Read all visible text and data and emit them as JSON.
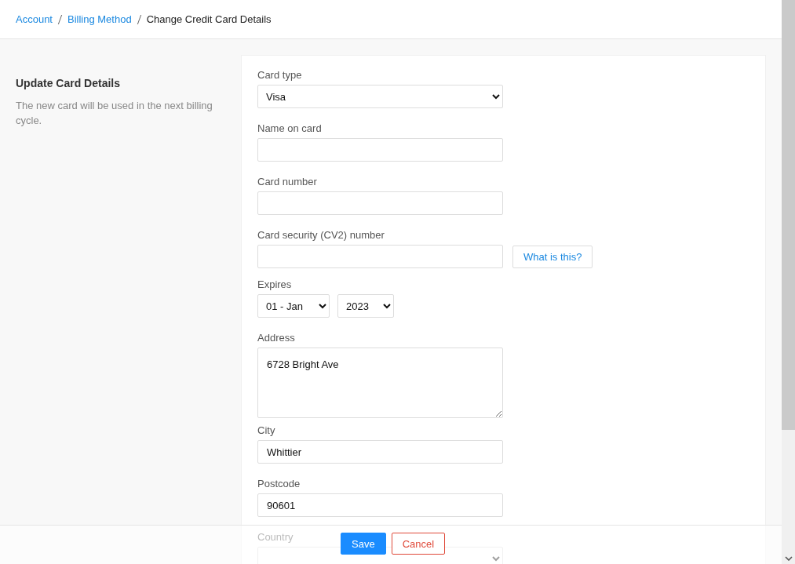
{
  "breadcrumb": [
    {
      "label": "Account",
      "kind": "link"
    },
    {
      "label": "Billing Method",
      "kind": "link"
    },
    {
      "label": "Change Credit Card Details",
      "kind": "current"
    }
  ],
  "intro": {
    "title": "Update Card Details",
    "description": "The new card will be used in the next billing cycle."
  },
  "form": {
    "fields": [
      {
        "kind": "select",
        "label": "Card type",
        "value": "Visa"
      },
      {
        "kind": "text",
        "label": "Name on card"
      },
      {
        "kind": "text",
        "label": "Card number"
      },
      {
        "kind": "text",
        "label": "Card security (CV2) number",
        "help_button": "What is this?"
      },
      {
        "kind": "expiry",
        "label": "Expires",
        "month": "01 - Jan",
        "year": "2023"
      },
      {
        "kind": "textarea",
        "label": "Address",
        "value": "6728 Bright Ave"
      },
      {
        "kind": "text",
        "label": "City",
        "value": "Whittier"
      },
      {
        "kind": "text",
        "label": "Postcode",
        "value": "90601"
      },
      {
        "kind": "select",
        "label": "Country"
      }
    ]
  },
  "footer": {
    "buttons": [
      {
        "label": "Save",
        "kind": "primary"
      },
      {
        "label": "Cancel",
        "kind": "danger"
      }
    ]
  }
}
